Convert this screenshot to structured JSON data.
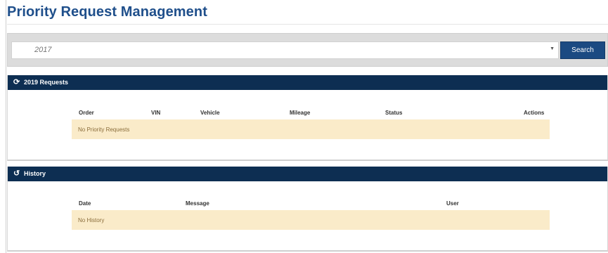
{
  "page": {
    "title": "Priority Request Management"
  },
  "search": {
    "selected_year": "2017",
    "button_label": "Search"
  },
  "requests": {
    "header": "2019 Requests",
    "icon": "refresh-icon",
    "columns": [
      "Order",
      "VIN",
      "Vehicle",
      "Mileage",
      "Status",
      "Actions"
    ],
    "empty_message": "No Priority Requests"
  },
  "history": {
    "header": "History",
    "icon": "history-icon",
    "columns": [
      "Date",
      "Message",
      "User"
    ],
    "empty_message": "No History"
  },
  "colors": {
    "header_bg": "#0d2e52",
    "title": "#1f4f8b",
    "button": "#1b4a82",
    "empty_row_bg": "#faebc9"
  }
}
